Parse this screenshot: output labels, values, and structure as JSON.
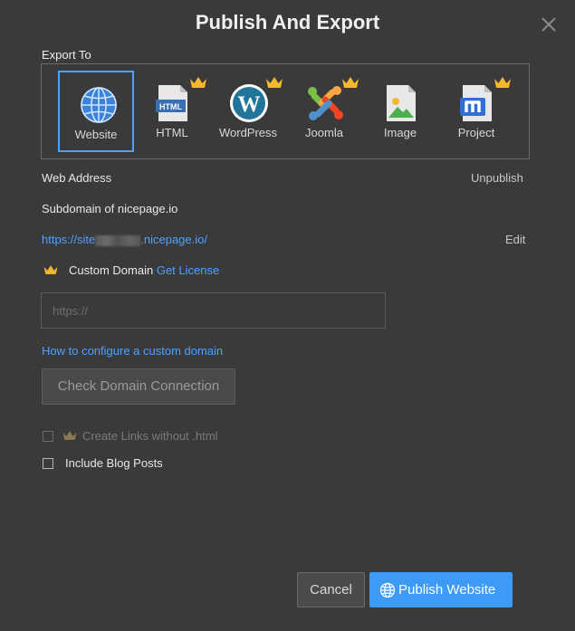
{
  "dialog": {
    "title": "Publish And Export"
  },
  "export_to": {
    "label": "Export To",
    "items": [
      {
        "label": "Website",
        "selected": true,
        "premium": false,
        "icon": "globe-icon"
      },
      {
        "label": "HTML",
        "selected": false,
        "premium": true,
        "icon": "html-file-icon"
      },
      {
        "label": "WordPress",
        "selected": false,
        "premium": true,
        "icon": "wordpress-icon"
      },
      {
        "label": "Joomla",
        "selected": false,
        "premium": true,
        "icon": "joomla-icon"
      },
      {
        "label": "Image",
        "selected": false,
        "premium": false,
        "icon": "image-file-icon"
      },
      {
        "label": "Project",
        "selected": false,
        "premium": true,
        "icon": "nicepage-project-icon"
      }
    ]
  },
  "web_address": {
    "label": "Web Address",
    "unpublish_label": "Unpublish"
  },
  "subdomain": {
    "label": "Subdomain of nicepage.io",
    "url_prefix": "https://site",
    "url_suffix": ".nicepage.io/",
    "edit_label": "Edit"
  },
  "custom_domain": {
    "label": "Custom Domain",
    "license_link": "Get License",
    "placeholder": "https://",
    "help_link": "How to configure a custom domain",
    "check_button": "Check Domain Connection"
  },
  "options": {
    "links_without_html": "Create Links without .html",
    "include_blog_posts": "Include Blog Posts"
  },
  "footer": {
    "cancel_label": "Cancel",
    "publish_label": "Publish Website"
  },
  "colors": {
    "background": "#3a3a3a",
    "accent": "#3d9bf5",
    "link": "#4ea1ff",
    "crown": "#f5b82e"
  }
}
